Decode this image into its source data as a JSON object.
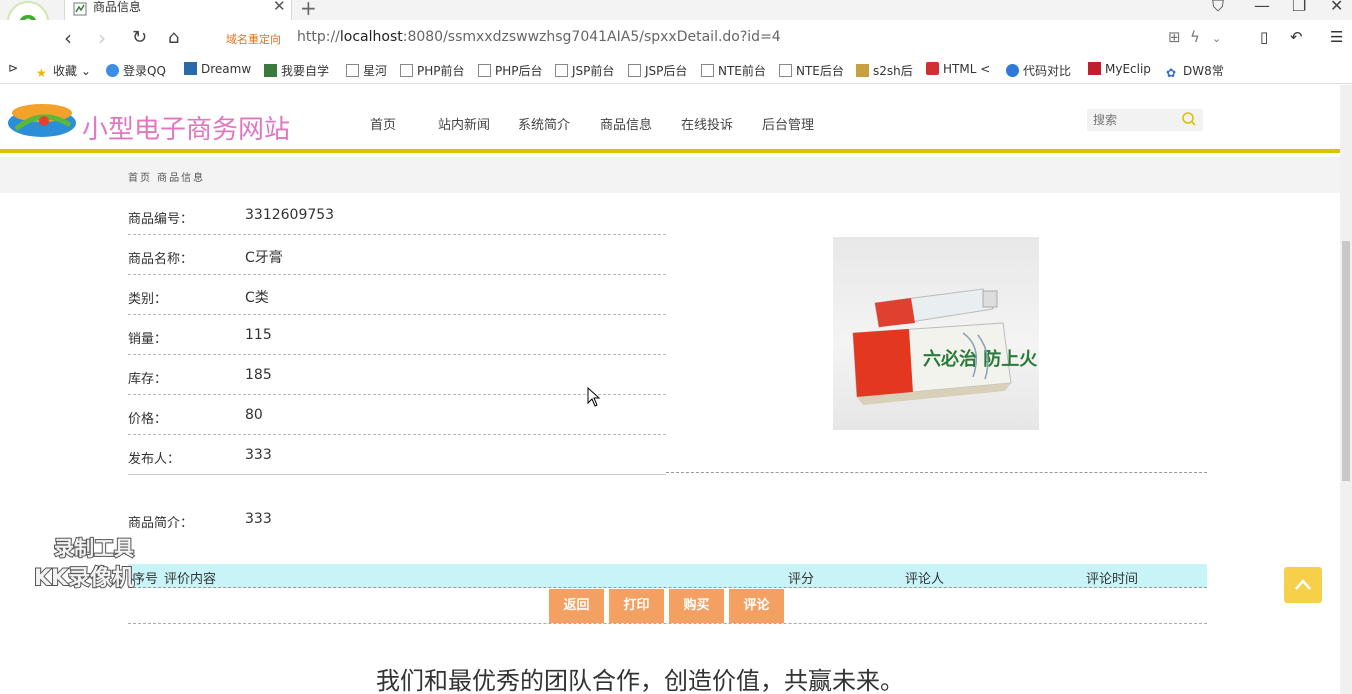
{
  "browser": {
    "tab_title": "商品信息",
    "tab_close": "✕",
    "new_tab": "+",
    "redirect_label": "域名重定向",
    "url_prefix": "http://",
    "url_host": "localhost",
    "url_rest": ":8080/ssmxxdzswwzhsg7041AIA5/spxxDetail.do?id=4",
    "bookmarks": [
      "收藏",
      "登录QQ",
      "Dreamw",
      "我要自学",
      "星河",
      "PHP前台",
      "PHP后台",
      "JSP前台",
      "JSP后台",
      "NTE前台",
      "NTE后台",
      "s2sh后",
      "HTML <",
      "代码对比",
      "MyEclip",
      "DW8常"
    ]
  },
  "site": {
    "name": "小型电子商务网站",
    "nav": [
      "首页",
      "站内新闻",
      "系统简介",
      "商品信息",
      "在线投诉",
      "后台管理"
    ],
    "search_placeholder": "搜索",
    "breadcrumb": "首页 商品信息"
  },
  "product": {
    "fields": [
      {
        "label": "商品编号：",
        "value": "3312609753"
      },
      {
        "label": "商品名称：",
        "value": "C牙膏"
      },
      {
        "label": "类别：",
        "value": "C类"
      },
      {
        "label": "销量：",
        "value": "115"
      },
      {
        "label": "库存：",
        "value": "185"
      },
      {
        "label": "价格：",
        "value": "80"
      },
      {
        "label": "发布人：",
        "value": "333"
      }
    ],
    "intro_label": "商品简介：",
    "intro_value": "333",
    "image_text": "六必治 防上火"
  },
  "reviews": {
    "headers": [
      "序号",
      "评价内容",
      "评分",
      "评论人",
      "评论时间"
    ]
  },
  "actions": [
    "返回",
    "打印",
    "购买",
    "评论"
  ],
  "footer": {
    "slogan": "我们和最优秀的团队合作，创造价值，共赢未来。"
  },
  "watermark": {
    "line1": "录制工具",
    "line2": "KK录像机"
  },
  "colors": {
    "accent_yellow": "#d9c300",
    "site_name": "#e077c0",
    "button": "#f4a062",
    "review_header": "#c8f4f8"
  }
}
